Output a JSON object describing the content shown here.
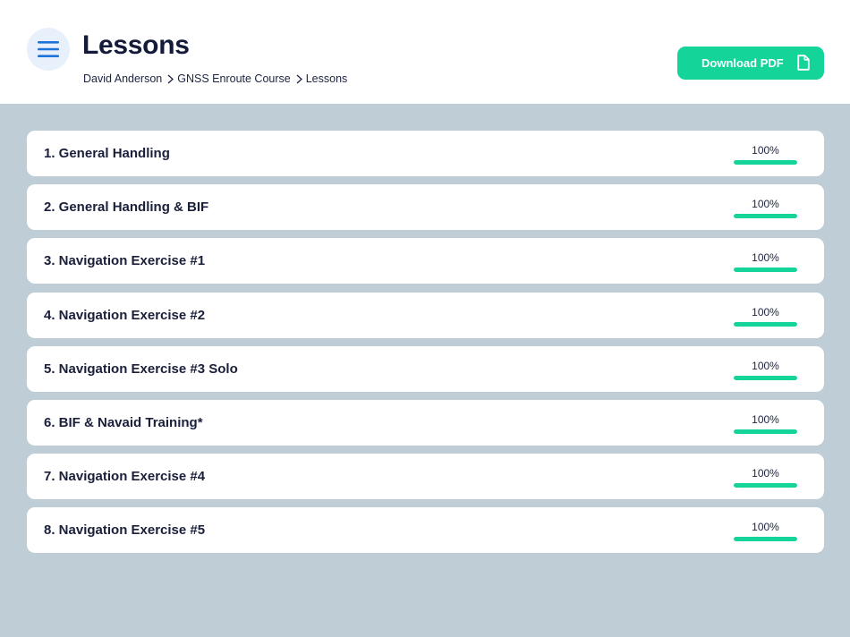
{
  "header": {
    "title": "Lessons",
    "breadcrumb": [
      "David Anderson",
      "GNSS Enroute Course",
      "Lessons"
    ],
    "download_label": "Download PDF",
    "menu_icon": "hamburger-icon",
    "download_icon": "document-icon"
  },
  "colors": {
    "accent": "#14d49a",
    "menu_blue": "#1e73d8",
    "background": "#bfcdd6",
    "text_dark": "#141a3a"
  },
  "lessons": [
    {
      "title": "1. General Handling",
      "progress_label": "100%",
      "progress": 1.0
    },
    {
      "title": "2. General Handling & BIF",
      "progress_label": "100%",
      "progress": 1.0
    },
    {
      "title": "3. Navigation Exercise #1",
      "progress_label": "100%",
      "progress": 1.0
    },
    {
      "title": "4. Navigation Exercise #2",
      "progress_label": "100%",
      "progress": 1.0
    },
    {
      "title": "5. Navigation Exercise #3 Solo",
      "progress_label": "100%",
      "progress": 1.0
    },
    {
      "title": "6. BIF & Navaid Training*",
      "progress_label": "100%",
      "progress": 1.0
    },
    {
      "title": "7. Navigation Exercise #4",
      "progress_label": "100%",
      "progress": 1.0
    },
    {
      "title": "8. Navigation Exercise #5",
      "progress_label": "100%",
      "progress": 1.0
    }
  ]
}
